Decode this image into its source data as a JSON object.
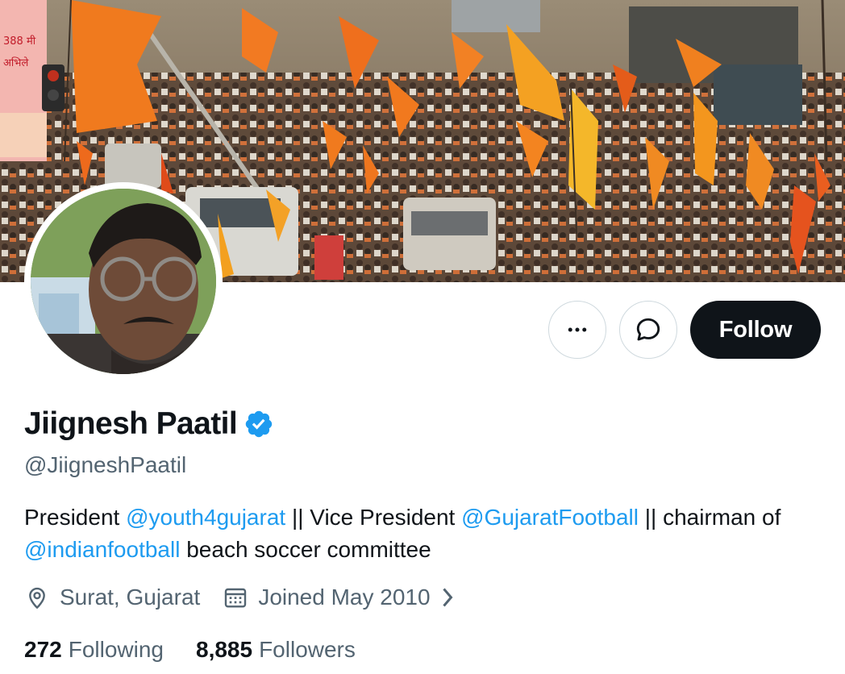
{
  "profile": {
    "display_name": "Jiignesh Paatil",
    "handle": "@JiigneshPaatil",
    "verified_icon": "verified-badge-icon",
    "bio": {
      "part1": "President ",
      "mention1": "@youth4gujarat",
      "part2": " || Vice President ",
      "mention2": "@GujaratFootball",
      "part3": " || chairman of ",
      "mention3": "@indianfootball",
      "part4": " beach soccer committee"
    },
    "location": "Surat, Gujarat",
    "joined": "Joined May 2010",
    "following_count": "272",
    "following_label": "Following",
    "followers_count": "8,885",
    "followers_label": "Followers"
  },
  "actions": {
    "more_icon": "more-options-icon",
    "message_icon": "message-icon",
    "follow_label": "Follow"
  },
  "banner": {
    "billboard_text_1": "388 मी",
    "billboard_text_2": "अभिले"
  },
  "colors": {
    "link": "#1d9bf0",
    "verified": "#1d9bf0",
    "primary_text": "#0f1419",
    "secondary_text": "#536471",
    "follow_button": "#0f1419",
    "flag_saffron": "#f07a1e"
  }
}
